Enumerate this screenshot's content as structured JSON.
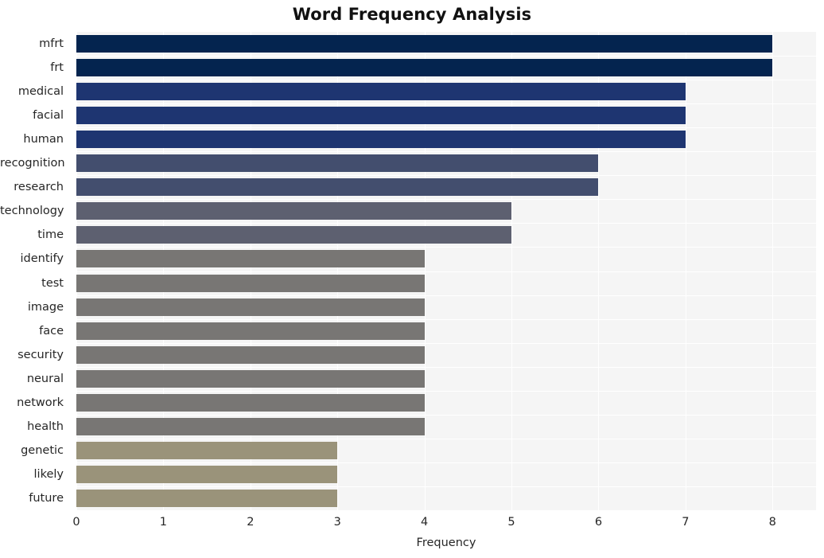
{
  "chart_data": {
    "type": "bar",
    "orientation": "horizontal",
    "title": "Word Frequency Analysis",
    "xlabel": "Frequency",
    "ylabel": "",
    "xlim": [
      0,
      8.5
    ],
    "xticks": [
      0,
      1,
      2,
      3,
      4,
      5,
      6,
      7,
      8
    ],
    "xtick_labels": [
      "0",
      "1",
      "2",
      "3",
      "4",
      "5",
      "6",
      "7",
      "8"
    ],
    "grid": true,
    "legend": false,
    "categories": [
      "mfrt",
      "frt",
      "medical",
      "facial",
      "human",
      "recognition",
      "research",
      "technology",
      "time",
      "identify",
      "test",
      "image",
      "face",
      "security",
      "neural",
      "network",
      "health",
      "genetic",
      "likely",
      "future"
    ],
    "values": [
      8,
      8,
      7,
      7,
      7,
      6,
      6,
      5,
      5,
      4,
      4,
      4,
      4,
      4,
      4,
      4,
      4,
      3,
      3,
      3
    ],
    "bar_colors": [
      "#04244f",
      "#04244f",
      "#1e3571",
      "#1e3571",
      "#1e3571",
      "#434e6e",
      "#434e6e",
      "#5d6070",
      "#5d6070",
      "#787674",
      "#787674",
      "#787674",
      "#787674",
      "#787674",
      "#787674",
      "#787674",
      "#787674",
      "#9a937a",
      "#9a937a",
      "#9a937a"
    ],
    "plot_background": "#f5f5f5",
    "grid_color": "#ffffff",
    "figure_background": "#ffffff",
    "text_color": "#262626"
  }
}
